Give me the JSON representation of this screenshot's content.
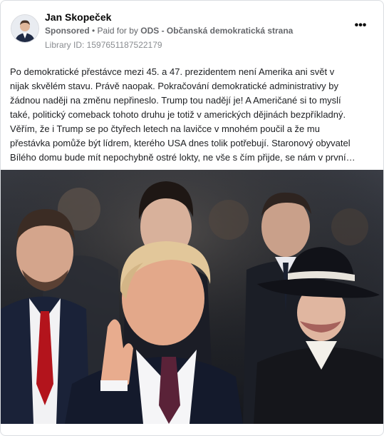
{
  "post": {
    "author_name": "Jan Skopeček",
    "sponsored_label": "Sponsored",
    "separator": " • ",
    "paid_for_by_prefix": "Paid for by ",
    "advertiser": "ODS - Občanská demokratická strana",
    "library_id": "Library ID: 1597651187522179",
    "more_label": "•••",
    "text_lines": [
      "Po demokratické přestávce mezi 45. a 47. prezidentem není Amerika ani svět v",
      "nijak skvělém stavu. Právě naopak. Pokračování demokratické administrativy by",
      "žádnou naději na změnu nepřineslo. Trump tou nadějí je! A Američané si to myslí",
      "také, politický comeback tohoto druhu je totiž v amerických dějinách bezpříkladný.",
      "Věřím, že i Trump se po čtyřech letech na lavičce v mnohém poučil a že mu",
      "přestávka pomůže být lídrem, kterého USA dnes tolik potřebují. Staronový obyvatel",
      "Bílého domu bude mít nepochybně ostré lokty, ne vše s čím přijde, se nám v první…"
    ]
  },
  "colors": {
    "name": "#050505",
    "meta": "#65676b",
    "library": "#8a8d91",
    "border": "#dadde1",
    "tie_red": "#b3141c",
    "hat_band": "#e8e4dc"
  }
}
